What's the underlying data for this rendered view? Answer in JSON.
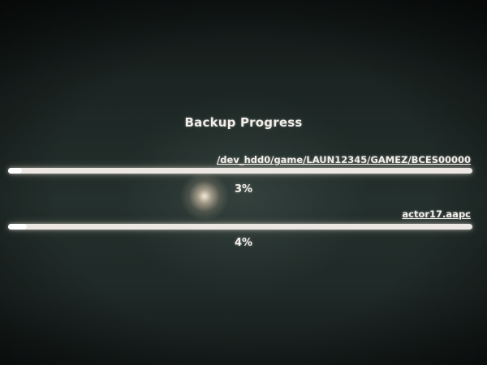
{
  "dialog": {
    "title": "Backup Progress"
  },
  "progress": [
    {
      "file": "/dev_hdd0/game/LAUN12345/GAMEZ/BCES00000",
      "percent_label": "3%",
      "percent": 3
    },
    {
      "file": "actor17.aapc",
      "percent_label": "4%",
      "percent": 4
    }
  ]
}
